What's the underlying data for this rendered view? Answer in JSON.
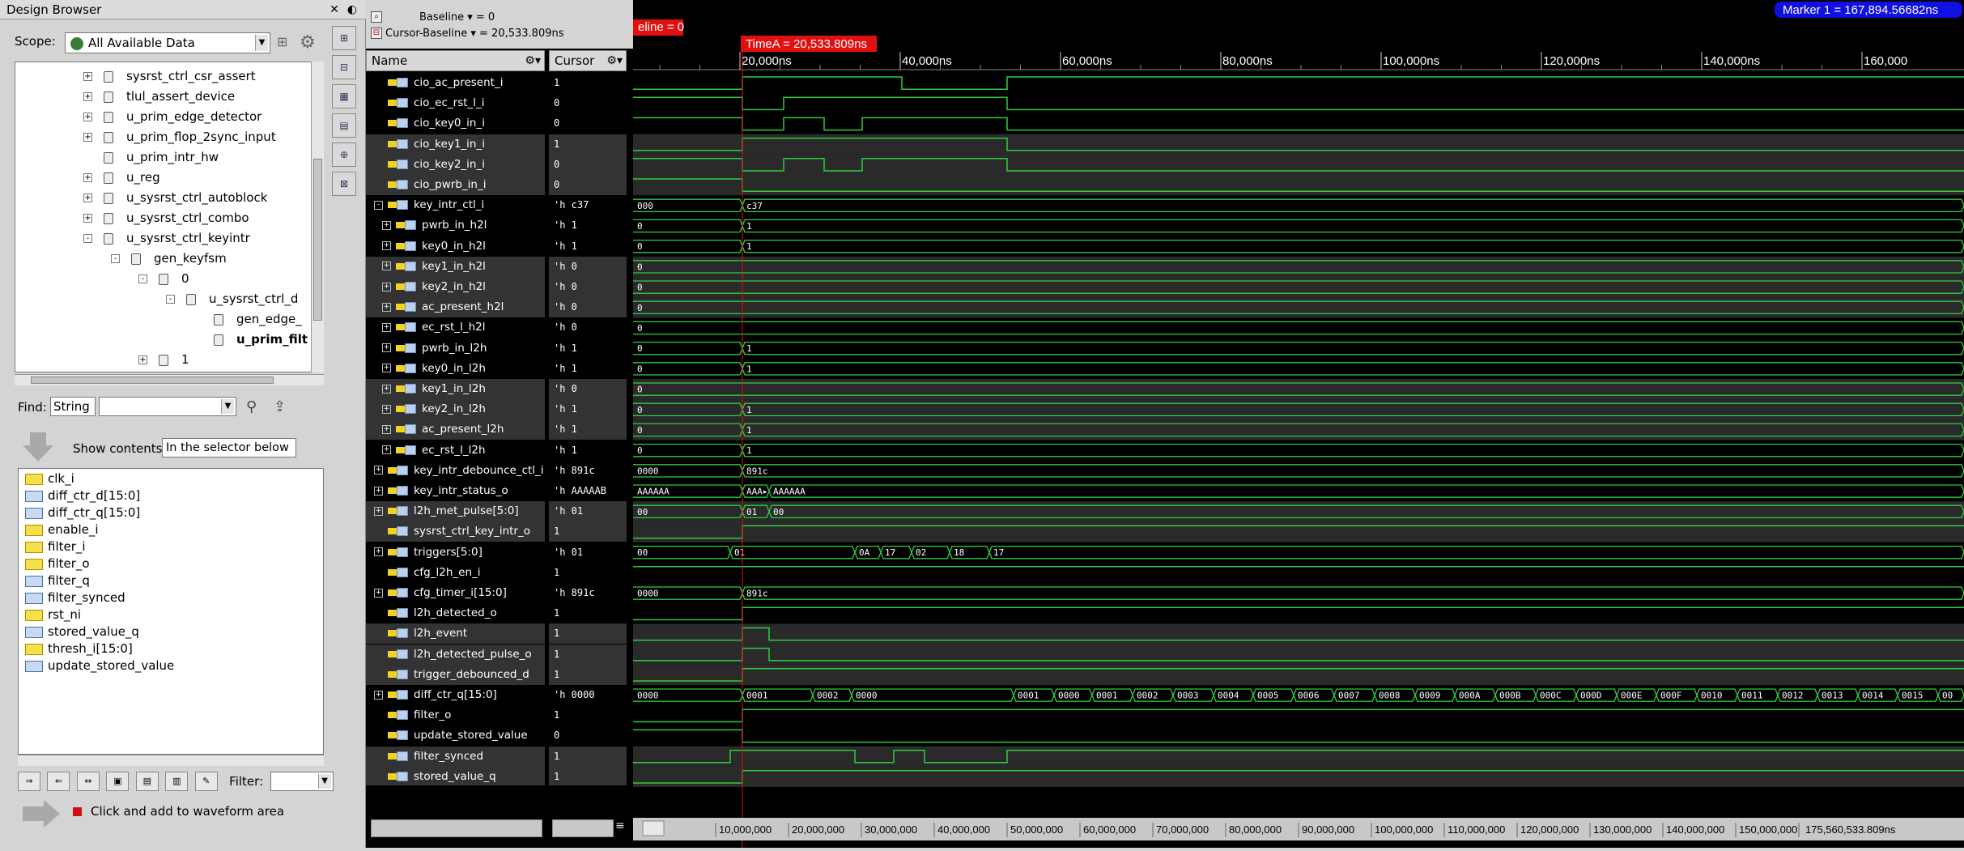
{
  "design_browser": {
    "title": "Design Browser",
    "scope_label": "Scope:",
    "scope_value": "All Available Data",
    "tree": [
      {
        "label": "sysrst_ctrl_csr_assert",
        "indent": 0,
        "exp": "+"
      },
      {
        "label": "tlul_assert_device",
        "indent": 0,
        "exp": "+"
      },
      {
        "label": "u_prim_edge_detector",
        "indent": 0,
        "exp": "+"
      },
      {
        "label": "u_prim_flop_2sync_input",
        "indent": 0,
        "exp": "+"
      },
      {
        "label": "u_prim_intr_hw",
        "indent": 0,
        "exp": ""
      },
      {
        "label": "u_reg",
        "indent": 0,
        "exp": "+"
      },
      {
        "label": "u_sysrst_ctrl_autoblock",
        "indent": 0,
        "exp": "+"
      },
      {
        "label": "u_sysrst_ctrl_combo",
        "indent": 0,
        "exp": "+"
      },
      {
        "label": "u_sysrst_ctrl_keyintr",
        "indent": 0,
        "exp": "-"
      },
      {
        "label": "gen_keyfsm",
        "indent": 1,
        "exp": "-"
      },
      {
        "label": "0",
        "indent": 2,
        "exp": "-"
      },
      {
        "label": "u_sysrst_ctrl_d",
        "indent": 3,
        "exp": "-"
      },
      {
        "label": "gen_edge_",
        "indent": 4,
        "exp": ""
      },
      {
        "label": "u_prim_filt",
        "indent": 4,
        "exp": "",
        "bold": true
      },
      {
        "label": "1",
        "indent": 2,
        "exp": "+"
      }
    ],
    "find_label": "Find:",
    "find_type": "String",
    "find_value": "",
    "show_contents_label": "Show contents:",
    "show_contents_value": "In the selector below",
    "contents": [
      {
        "label": "clk_i",
        "kind": "in"
      },
      {
        "label": "diff_ctr_d[15:0]",
        "kind": "reg"
      },
      {
        "label": "diff_ctr_q[15:0]",
        "kind": "reg"
      },
      {
        "label": "enable_i",
        "kind": "in"
      },
      {
        "label": "filter_i",
        "kind": "in"
      },
      {
        "label": "filter_o",
        "kind": "out"
      },
      {
        "label": "filter_q",
        "kind": "reg"
      },
      {
        "label": "filter_synced",
        "kind": "reg"
      },
      {
        "label": "rst_ni",
        "kind": "in"
      },
      {
        "label": "stored_value_q",
        "kind": "reg"
      },
      {
        "label": "thresh_i[15:0]",
        "kind": "in"
      },
      {
        "label": "update_stored_value",
        "kind": "reg"
      }
    ],
    "filter_label": "Filter:",
    "filter_value": "",
    "click_add_label": "Click and add to waveform area"
  },
  "waveform": {
    "baseline": "Baseline ▾ = 0",
    "cursor_baseline": "Cursor-Baseline ▾ = 20,533.809ns",
    "baseline_tag": "eline = 0",
    "timea_tag": "TimeA = 20,533.809ns",
    "marker_tag": "Marker 1 = 167,894.56682ns",
    "name_header": "Name",
    "cursor_header": "Cursor",
    "time_ticks": [
      "20,000ns",
      "40,000ns",
      "60,000ns",
      "80,000ns",
      "100,000ns",
      "120,000ns",
      "140,000ns",
      "160,000"
    ],
    "bottom_ticks": [
      "10,000,000",
      "20,000,000",
      "30,000,000",
      "40,000,000",
      "50,000,000",
      "60,000,000",
      "70,000,000",
      "80,000,000",
      "90,000,000",
      "100,000,000",
      "110,000,000",
      "120,000,000",
      "130,000,000",
      "140,000,000",
      "150,000,000",
      "175,560,533.809ns"
    ],
    "signals": [
      {
        "name": "cio_ac_present_i",
        "val": "1",
        "indent": 0,
        "exp": "",
        "type": "bit"
      },
      {
        "name": "cio_ec_rst_l_i",
        "val": "0",
        "indent": 0,
        "exp": "",
        "type": "bit"
      },
      {
        "name": "cio_key0_in_i",
        "val": "0",
        "indent": 0,
        "exp": "",
        "type": "bit"
      },
      {
        "name": "cio_key1_in_i",
        "val": "1",
        "indent": 0,
        "exp": "",
        "type": "bit"
      },
      {
        "name": "cio_key2_in_i",
        "val": "0",
        "indent": 0,
        "exp": "",
        "type": "bit"
      },
      {
        "name": "cio_pwrb_in_i",
        "val": "0",
        "indent": 0,
        "exp": "",
        "type": "bit"
      },
      {
        "name": "key_intr_ctl_i",
        "val": "'h c37",
        "indent": 0,
        "exp": "-",
        "type": "bus"
      },
      {
        "name": "pwrb_in_h2l",
        "val": "'h 1",
        "indent": 1,
        "exp": "+",
        "type": "bus"
      },
      {
        "name": "key0_in_h2l",
        "val": "'h 1",
        "indent": 1,
        "exp": "+",
        "type": "bus"
      },
      {
        "name": "key1_in_h2l",
        "val": "'h 0",
        "indent": 1,
        "exp": "+",
        "type": "bus"
      },
      {
        "name": "key2_in_h2l",
        "val": "'h 0",
        "indent": 1,
        "exp": "+",
        "type": "bus"
      },
      {
        "name": "ac_present_h2l",
        "val": "'h 0",
        "indent": 1,
        "exp": "+",
        "type": "bus"
      },
      {
        "name": "ec_rst_l_h2l",
        "val": "'h 0",
        "indent": 1,
        "exp": "+",
        "type": "bus"
      },
      {
        "name": "pwrb_in_l2h",
        "val": "'h 1",
        "indent": 1,
        "exp": "+",
        "type": "bus"
      },
      {
        "name": "key0_in_l2h",
        "val": "'h 1",
        "indent": 1,
        "exp": "+",
        "type": "bus"
      },
      {
        "name": "key1_in_l2h",
        "val": "'h 0",
        "indent": 1,
        "exp": "+",
        "type": "bus"
      },
      {
        "name": "key2_in_l2h",
        "val": "'h 1",
        "indent": 1,
        "exp": "+",
        "type": "bus"
      },
      {
        "name": "ac_present_l2h",
        "val": "'h 1",
        "indent": 1,
        "exp": "+",
        "type": "bus"
      },
      {
        "name": "ec_rst_l_l2h",
        "val": "'h 1",
        "indent": 1,
        "exp": "+",
        "type": "bus"
      },
      {
        "name": "key_intr_debounce_ctl_i",
        "val": "'h 891c",
        "indent": 0,
        "exp": "+",
        "type": "bus"
      },
      {
        "name": "key_intr_status_o",
        "val": "'h AAAAAB",
        "indent": 0,
        "exp": "+",
        "type": "bus"
      },
      {
        "name": "l2h_met_pulse[5:0]",
        "val": "'h 01",
        "indent": 0,
        "exp": "+",
        "type": "bus"
      },
      {
        "name": "sysrst_ctrl_key_intr_o",
        "val": "1",
        "indent": 0,
        "exp": "",
        "type": "bit"
      },
      {
        "name": "triggers[5:0]",
        "val": "'h 01",
        "indent": 0,
        "exp": "+",
        "type": "bus"
      },
      {
        "name": "cfg_l2h_en_i",
        "val": "1",
        "indent": 0,
        "exp": "",
        "type": "bit"
      },
      {
        "name": "cfg_timer_i[15:0]",
        "val": "'h 891c",
        "indent": 0,
        "exp": "+",
        "type": "bus"
      },
      {
        "name": "l2h_detected_o",
        "val": "1",
        "indent": 0,
        "exp": "",
        "type": "bit"
      },
      {
        "name": "l2h_event",
        "val": "1",
        "indent": 0,
        "exp": "",
        "type": "bit"
      },
      {
        "name": "l2h_detected_pulse_o",
        "val": "1",
        "indent": 0,
        "exp": "",
        "type": "bit"
      },
      {
        "name": "trigger_debounced_d",
        "val": "1",
        "indent": 0,
        "exp": "",
        "type": "bit"
      },
      {
        "name": "diff_ctr_q[15:0]",
        "val": "'h 0000",
        "indent": 0,
        "exp": "+",
        "type": "bus"
      },
      {
        "name": "filter_o",
        "val": "1",
        "indent": 0,
        "exp": "",
        "type": "bit"
      },
      {
        "name": "update_stored_value",
        "val": "0",
        "indent": 0,
        "exp": "",
        "type": "bit"
      },
      {
        "name": "filter_synced",
        "val": "1",
        "indent": 0,
        "exp": "",
        "type": "bit"
      },
      {
        "name": "stored_value_q",
        "val": "1",
        "indent": 0,
        "exp": "",
        "type": "bit"
      }
    ],
    "bus_labels": [
      [
        "000",
        "c37"
      ],
      [
        "0",
        "1"
      ],
      [
        "0",
        "1"
      ],
      [
        "0"
      ],
      [
        "0"
      ],
      [
        "0"
      ],
      [
        "0"
      ],
      [
        "0",
        "1"
      ],
      [
        "0",
        "1"
      ],
      [
        "0"
      ],
      [
        "0",
        "1"
      ],
      [
        "0",
        "1"
      ],
      [
        "0",
        "1"
      ],
      [
        "0000",
        "891c"
      ],
      [
        "AAAAAA",
        "AAA▸",
        "AAAAAA"
      ],
      [
        "00",
        "01",
        "00"
      ],
      [
        "00",
        "01",
        "0A",
        "17",
        "02",
        "18",
        "17"
      ],
      [
        "0000",
        "891c"
      ],
      [
        "0000",
        "0001",
        "0002",
        "0000",
        "0001",
        "0000",
        "0001",
        "0002",
        "0003",
        "0004",
        "0005",
        "0006",
        "0007",
        "0008",
        "0009",
        "000A",
        "000B",
        "000C",
        "000D",
        "000E",
        "000F",
        "0010",
        "0011",
        "0012",
        "0013",
        "0014",
        "0015",
        "00"
      ]
    ]
  }
}
